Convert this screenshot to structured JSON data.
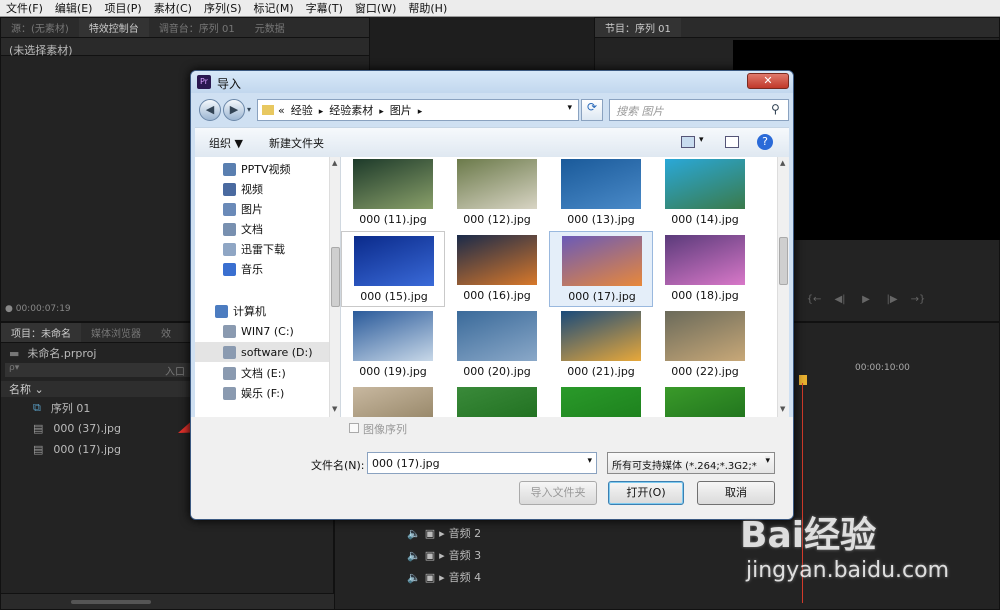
{
  "menubar": [
    "文件(F)",
    "编辑(E)",
    "项目(P)",
    "素材(C)",
    "序列(S)",
    "标记(M)",
    "字幕(T)",
    "窗口(W)",
    "帮助(H)"
  ],
  "source_panel": {
    "tabs": [
      "源：(无素材)",
      "特效控制台",
      "调音台：序列 01",
      "元数据"
    ],
    "no_clip": "(未选择素材)",
    "timecode": "00:00:07:19"
  },
  "program_panel": {
    "tab": "节目：序列 01"
  },
  "project_panel": {
    "tabs": [
      "项目：未命名",
      "媒体浏览器",
      "效"
    ],
    "project_file": "未命名.prproj",
    "name_header": "名称",
    "in_label": "入口",
    "items": [
      "序列 01",
      "000 (37).jpg",
      "000 (17).jpg"
    ]
  },
  "timeline": {
    "timecode": "00:00:10:00",
    "tracks": [
      "音频 2",
      "音频 3",
      "音频 4"
    ]
  },
  "dialog": {
    "title": "导入",
    "close": "✕",
    "breadcrumb": [
      "«",
      "经验",
      "经验素材",
      "图片"
    ],
    "search_placeholder": "搜索 图片",
    "organize": "组织 ▼",
    "new_folder": "新建文件夹",
    "nav_items": [
      {
        "label": "PPTV视频",
        "icon": "video-folder-icon",
        "color": "#5a7fb0"
      },
      {
        "label": "视频",
        "icon": "video-library-icon",
        "color": "#4a6aa0"
      },
      {
        "label": "图片",
        "icon": "pictures-library-icon",
        "color": "#6a8ab8"
      },
      {
        "label": "文档",
        "icon": "documents-library-icon",
        "color": "#7890b0"
      },
      {
        "label": "迅雷下载",
        "icon": "download-folder-icon",
        "color": "#8fa6c4"
      },
      {
        "label": "音乐",
        "icon": "music-library-icon",
        "color": "#3a6fd0"
      },
      {
        "label": "计算机",
        "icon": "computer-icon",
        "color": "#4c7cc0"
      },
      {
        "label": "WIN7 (C:)",
        "icon": "drive-icon",
        "color": "#8a9ab0"
      },
      {
        "label": "software (D:)",
        "icon": "drive-icon",
        "color": "#8a9ab0"
      },
      {
        "label": "文档 (E:)",
        "icon": "drive-icon",
        "color": "#8a9ab0"
      },
      {
        "label": "娱乐 (F:)",
        "icon": "drive-icon",
        "color": "#8a9ab0"
      }
    ],
    "thumbnails": [
      {
        "name": "000 (11).jpg",
        "c1": "#1d3a2a",
        "c2": "#8aa06a"
      },
      {
        "name": "000 (12).jpg",
        "c1": "#6b7a4a",
        "c2": "#d8d4c4"
      },
      {
        "name": "000 (13).jpg",
        "c1": "#1a5a9a",
        "c2": "#4a8ac8"
      },
      {
        "name": "000 (14).jpg",
        "c1": "#2aa8d8",
        "c2": "#3a7a4a"
      },
      {
        "name": "000 (15).jpg",
        "c1": "#0a2a8a",
        "c2": "#3a6ad8"
      },
      {
        "name": "000 (16).jpg",
        "c1": "#1a2a4a",
        "c2": "#d8782a"
      },
      {
        "name": "000 (17).jpg",
        "c1": "#6a5ab8",
        "c2": "#e8883a"
      },
      {
        "name": "000 (18).jpg",
        "c1": "#5a3a7a",
        "c2": "#d878c8"
      },
      {
        "name": "000 (19).jpg",
        "c1": "#2a5a9a",
        "c2": "#c8d8e8"
      },
      {
        "name": "000 (20).jpg",
        "c1": "#3a6a9a",
        "c2": "#8aa8c8"
      },
      {
        "name": "000 (21).jpg",
        "c1": "#1a4a7a",
        "c2": "#e8a83a"
      },
      {
        "name": "000 (22).jpg",
        "c1": "#6a6a5a",
        "c2": "#c8a878"
      },
      {
        "name": "",
        "c1": "#c8b8a0",
        "c2": "#8a7a5a"
      },
      {
        "name": "",
        "c1": "#3a8a3a",
        "c2": "#1a6a1a"
      },
      {
        "name": "",
        "c1": "#2a9a2a",
        "c2": "#1a7a1a"
      },
      {
        "name": "",
        "c1": "#3a9a2a",
        "c2": "#1a6a1a"
      }
    ],
    "image_sequence_label": "图像序列",
    "filename_label": "文件名(N):",
    "filename_value": "000 (17).jpg",
    "filter_value": "所有可支持媒体 (*.264;*.3G2;*",
    "import_folder": "导入文件夹",
    "open": "打开(O)",
    "cancel": "取消"
  },
  "watermark": {
    "brand": "Bai经验",
    "url": "jingyan.baidu.com"
  },
  "colors": {
    "arrow": "#e0302a",
    "accent": "#3c78c8"
  }
}
